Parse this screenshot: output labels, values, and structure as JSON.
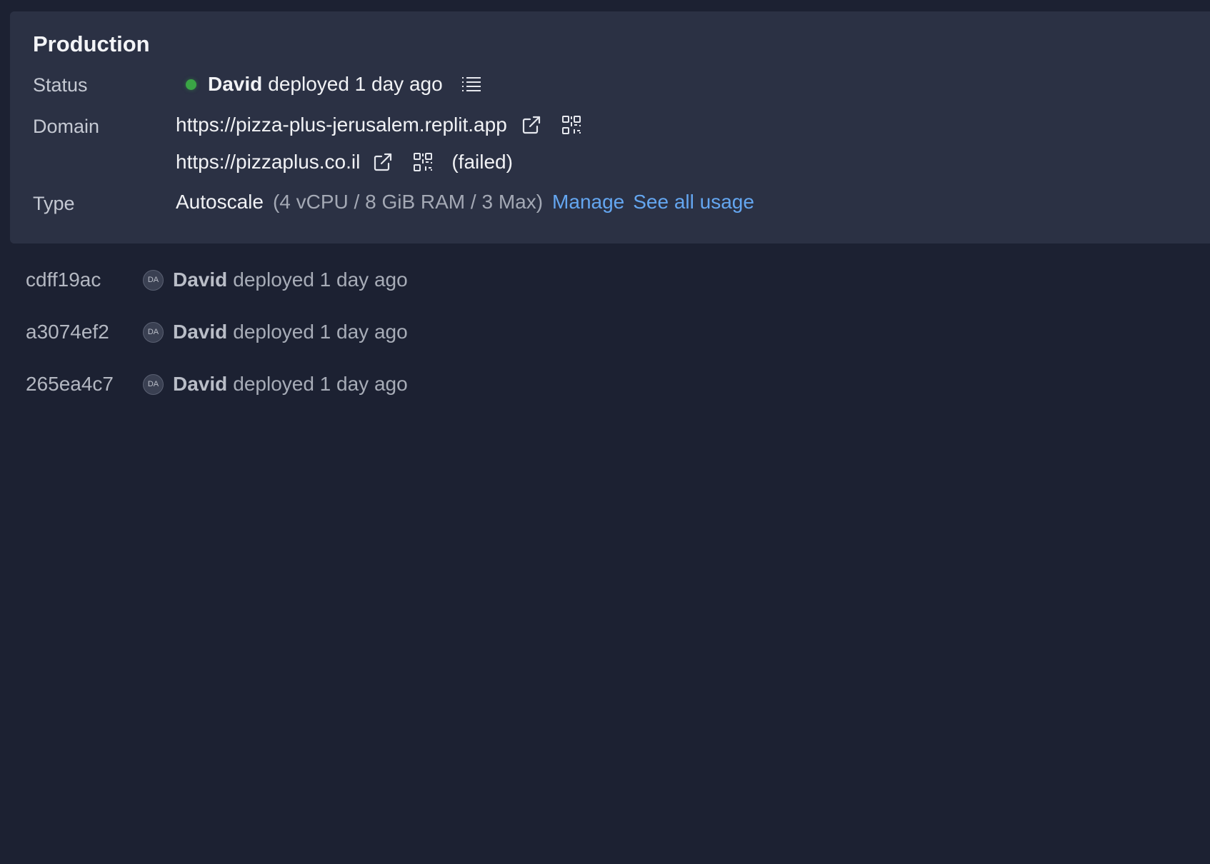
{
  "production": {
    "title": "Production",
    "status": {
      "label": "Status",
      "user": "David",
      "text": "deployed 1 day ago",
      "dot_color": "#3aa545",
      "logs_icon": "list-icon"
    },
    "domain": {
      "label": "Domain",
      "urls": [
        {
          "url": "https://pizza-plus-jerusalem.replit.app",
          "note": ""
        },
        {
          "url": "https://pizzaplus.co.il",
          "note": "(failed)"
        }
      ],
      "external_icon": "external-link-icon",
      "qr_icon": "qr-code-icon"
    },
    "type": {
      "label": "Type",
      "value": "Autoscale",
      "spec": "(4 vCPU / 8 GiB RAM / 3 Max)",
      "manage_label": "Manage",
      "usage_label": "See all usage"
    }
  },
  "deployments": [
    {
      "hash": "cdff19ac",
      "initials": "DA",
      "user": "David",
      "text": "deployed 1 day ago"
    },
    {
      "hash": "a3074ef2",
      "initials": "DA",
      "user": "David",
      "text": "deployed 1 day ago"
    },
    {
      "hash": "265ea4c7",
      "initials": "DA",
      "user": "David",
      "text": "deployed 1 day ago"
    }
  ],
  "colors": {
    "background": "#1c2132",
    "card": "#2b3144",
    "link": "#64a6f0",
    "status_ok": "#3aa545"
  }
}
